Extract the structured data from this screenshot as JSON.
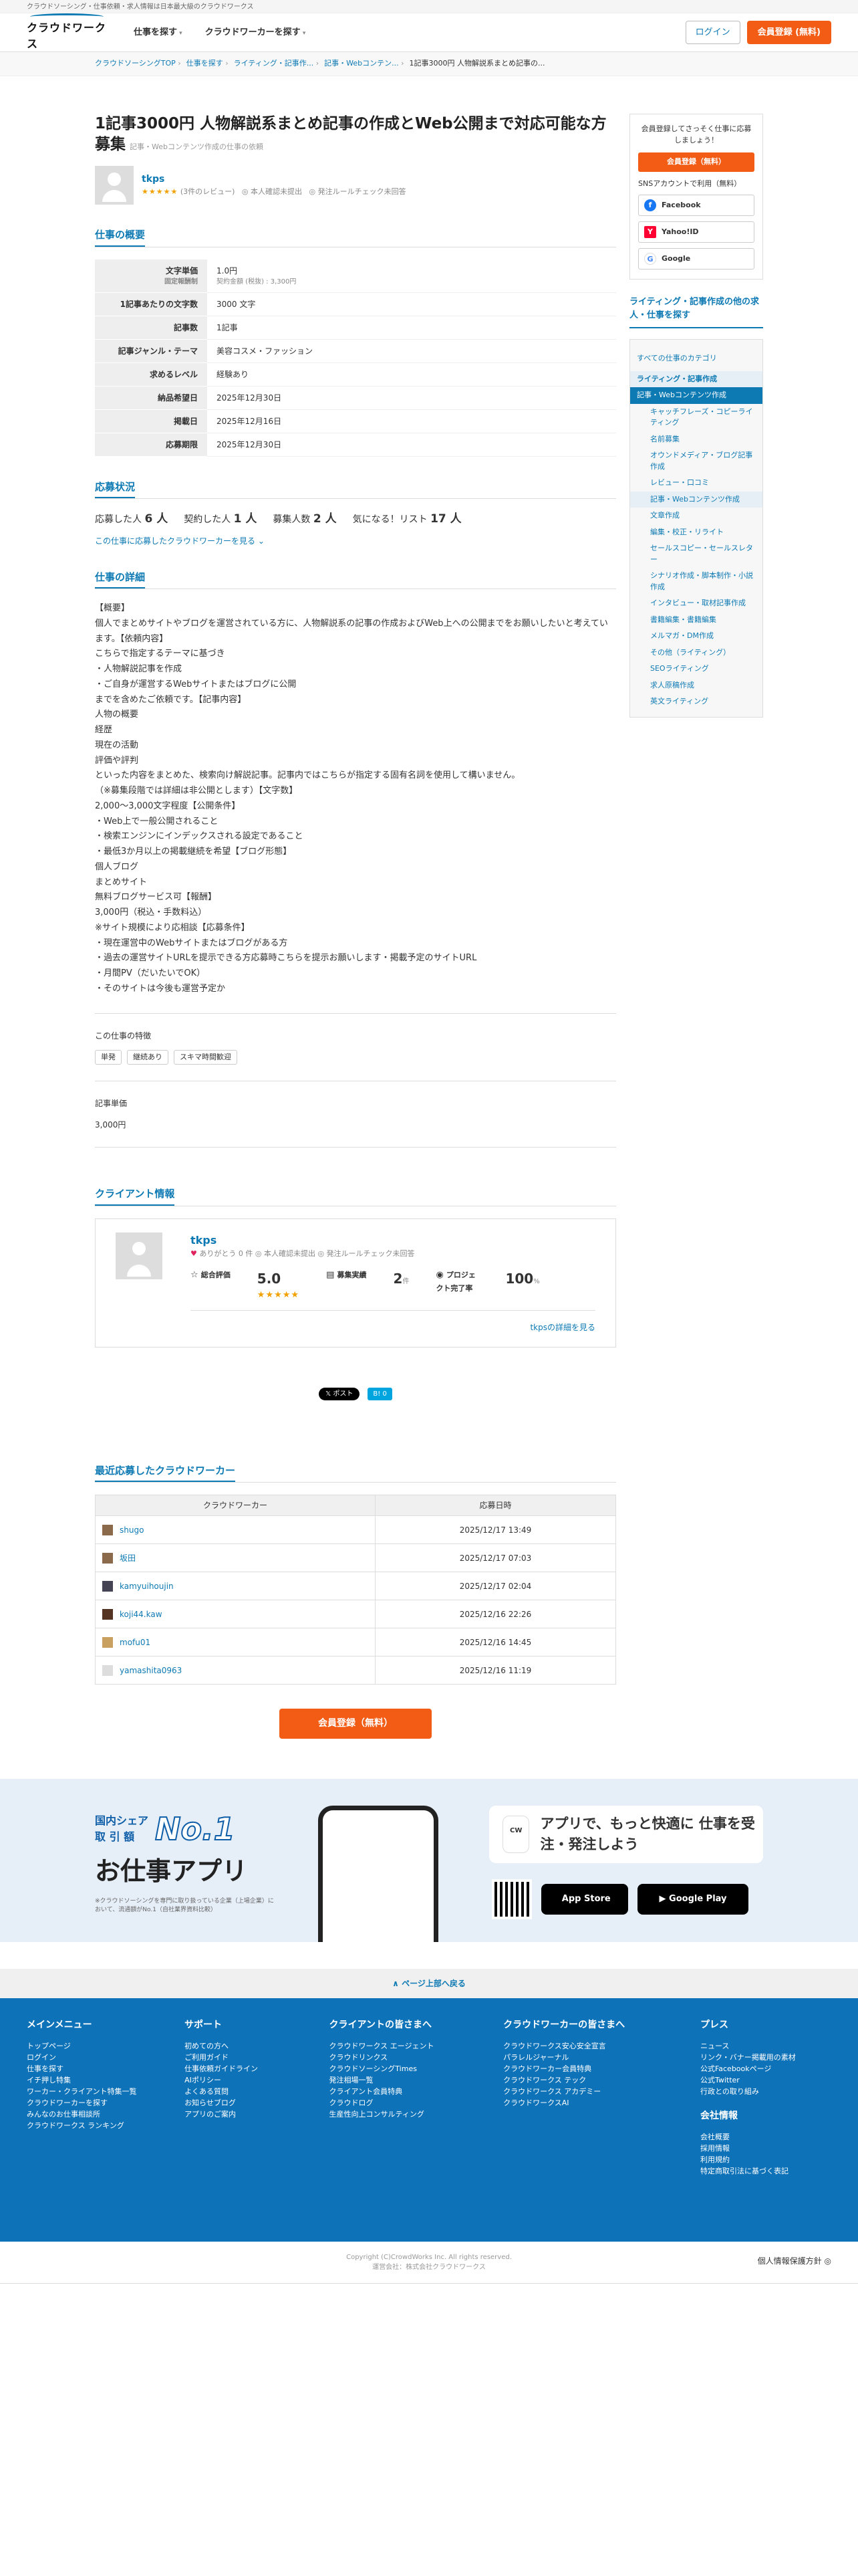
{
  "topbar": "クラウドソーシング・仕事依頼・求人情報は日本最大級のクラウドワークス",
  "header": {
    "logo": "クラウドワークス",
    "nav": [
      "仕事を探す",
      "クラウドワーカーを探す"
    ],
    "login": "ログイン",
    "register": "会員登録 (無料)"
  },
  "breadcrumb": [
    "クラウドソーシングTOP",
    "仕事を探す",
    "ライティング・記事作...",
    "記事・Webコンテン...",
    "1記事3000円 人物解説系まとめ記事の..."
  ],
  "job": {
    "title": "1記事3000円 人物解説系まとめ記事の作成とWeb公開まで対応可能な方募集",
    "category": "記事・Webコンテンツ作成の仕事の依頼"
  },
  "client": {
    "name": "tkps",
    "stars": "★★★★★",
    "reviews": "(3件のレビュー)",
    "identity": "本人確認未提出",
    "compliance": "発注ルールチェック未回答"
  },
  "overview": {
    "heading": "仕事の概要",
    "rows": [
      {
        "label": "文字単価",
        "sub": "固定報酬制",
        "value": "1.0円",
        "value_sub": "契約金額 (税抜) : 3,300円"
      },
      {
        "label": "1記事あたりの文字数",
        "value": "3000 文字"
      },
      {
        "label": "記事数",
        "value": "1記事"
      },
      {
        "label": "記事ジャンル・テーマ",
        "value": "美容コスメ・ファッション"
      },
      {
        "label": "求めるレベル",
        "value": "経験あり"
      },
      {
        "label": "納品希望日",
        "value": "2025年12月30日"
      },
      {
        "label": "掲載日",
        "value": "2025年12月16日"
      },
      {
        "label": "応募期限",
        "value": "2025年12月30日"
      }
    ]
  },
  "status": {
    "heading": "応募状況",
    "applicants_label": "応募した人",
    "applicants": "6 人",
    "contracted_label": "契約した人",
    "contracted": "1 人",
    "recruit_label": "募集人数",
    "recruit": "2 人",
    "watch_label": "気になる！リスト",
    "watch": "17 人",
    "more": "この仕事に応募したクラウドワーカーを見る"
  },
  "details": {
    "heading": "仕事の詳細",
    "text": "【概要】\n個人でまとめサイトやブログを運営されている方に、人物解説系の記事の作成およびWeb上への公開までをお願いしたいと考えています。【依頼内容】\nこちらで指定するテーマに基づき\n・人物解説記事を作成\n・ご自身が運営するWebサイトまたはブログに公開\nまでを含めたご依頼です。【記事内容】\n人物の概要\n経歴\n現在の活動\n評価や評判\nといった内容をまとめた、検索向け解説記事。記事内ではこちらが指定する固有名詞を使用して構いません。\n（※募集段階では詳細は非公開とします）【文字数】\n2,000〜3,000文字程度【公開条件】\n・Web上で一般公開されること\n・検索エンジンにインデックスされる設定であること\n・最低3か月以上の掲載継続を希望【ブログ形態】\n個人ブログ\nまとめサイト\n無料ブログサービス可【報酬】\n3,000円（税込・手数料込）\n※サイト規模により応相談【応募条件】\n・現在運営中のWebサイトまたはブログがある方\n・過去の運営サイトURLを提示できる方応募時こちらを提示お願いします・掲載予定のサイトURL\n・月間PV（だいたいでOK）\n・そのサイトは今後も運営予定か",
    "features_label": "この仕事の特徴",
    "features": [
      "単発",
      "継続あり",
      "スキマ時間歓迎"
    ],
    "price_label": "記事単価",
    "price": "3,000円"
  },
  "client_info": {
    "heading": "クライアント情報",
    "name": "tkps",
    "thanks": "ありがとう 0 件",
    "identity": "本人確認未提出",
    "compliance": "発注ルールチェック未回答",
    "rating_label": "総合評価",
    "rating": "5.0",
    "stars": "★★★★★",
    "jobs_label": "募集実績",
    "jobs": "2",
    "jobs_unit": "件",
    "completion_label": "プロジェクト完了率",
    "completion": "100",
    "completion_unit": "%",
    "detail_link": "tkpsの詳細を見る"
  },
  "share": {
    "x": "𝕏 ポスト",
    "hatena": "B! 0"
  },
  "recent": {
    "heading": "最近応募したクラウドワーカー",
    "col_worker": "クラウドワーカー",
    "col_date": "応募日時",
    "rows": [
      {
        "name": "shugo",
        "date": "2025/12/17 13:49"
      },
      {
        "name": "坂田",
        "date": "2025/12/17 07:03"
      },
      {
        "name": "kamyuihoujin",
        "date": "2025/12/17 02:04"
      },
      {
        "name": "koji44.kaw",
        "date": "2025/12/16 22:26"
      },
      {
        "name": "mofu01",
        "date": "2025/12/16 14:45"
      },
      {
        "name": "yamashita0963",
        "date": "2025/12/16 11:19"
      }
    ]
  },
  "cta": "会員登録（無料）",
  "sidebar": {
    "lead": "会員登録してさっそく仕事に応募しましょう！",
    "register": "会員登録（無料）",
    "sns_label": "SNSアカウントで利用（無料）",
    "facebook": "Facebook",
    "yahoo": "Yahoo!ID",
    "google": "Google",
    "cat_heading": "ライティング・記事作成の他の求人・仕事を探す",
    "cat_all": "すべての仕事のカテゴリ",
    "cat_top": "ライティング・記事作成",
    "cat_selected": "記事・Webコンテンツ作成",
    "cats": [
      "キャッチフレーズ・コピーライティング",
      "名前募集",
      "オウンドメディア・ブログ記事作成",
      "レビュー・口コミ",
      "記事・Webコンテンツ作成",
      "文章作成",
      "編集・校正・リライト",
      "セールスコピー・セールスレター",
      "シナリオ作成・脚本制作・小説作成",
      "インタビュー・取材記事作成",
      "書籍編集・書籍編集",
      "メルマガ・DM作成",
      "その他（ライティング）",
      "SEOライティング",
      "求人原稿作成",
      "英文ライティング"
    ]
  },
  "promo": {
    "share_label": "国内シェア",
    "amount_label": "取 引 額",
    "no1": "No.1",
    "app": "お仕事アプリ",
    "note": "※クラウドソーシングを専門に取り扱っている企業（上場企業）において、流通額がNo.1（自社業界資料比較）",
    "bubble": "アプリで、もっと快適に 仕事を受注・発注しよう",
    "appstore": "App Store",
    "googleplay": "Google Play"
  },
  "gotop": "∧ ページ上部へ戻る",
  "footer": {
    "cols": [
      {
        "title": "メインメニュー",
        "items": [
          "トップページ",
          "ログイン",
          "仕事を探す",
          "イチ押し特集",
          "ワーカー・クライアント特集一覧",
          "クラウドワーカーを探す",
          "みんなのお仕事相談所",
          "クラウドワークス ランキング"
        ]
      },
      {
        "title": "サポート",
        "items": [
          "初めての方へ",
          "ご利用ガイド",
          "仕事依頼ガイドライン",
          "AIポリシー",
          "よくある質問",
          "お知らせブログ",
          "アプリのご案内"
        ]
      },
      {
        "title": "クライアントの皆さまへ",
        "items": [
          "クラウドワークス エージェント",
          "クラウドリンクス",
          "クラウドソーシングTimes",
          "発注相場一覧",
          "クライアント会員特典",
          "クラウドログ",
          "生産性向上コンサルティング"
        ]
      },
      {
        "title": "クラウドワーカーの皆さまへ",
        "items": [
          "クラウドワークス安心安全宣言",
          "パラレルジャーナル",
          "クラウドワーカー会員特典",
          "クラウドワークス テック",
          "クラウドワークス アカデミー",
          "クラウドワークスAI"
        ]
      },
      {
        "title": "プレス",
        "items": [
          "ニュース",
          "リンク・バナー掲載用の素材",
          "公式Facebookページ",
          "公式Twitter",
          "行政との取り組み"
        ]
      }
    ],
    "company_title": "会社情報",
    "company": [
      "会社概要",
      "採用情報",
      "利用規約",
      "特定商取引法に基づく表記"
    ]
  },
  "copyright": "Copyright (C)CrowdWorks Inc. All rights reserved.",
  "operator": "運営会社：株式会社クラウドワークス",
  "privacy": "個人情報保護方針"
}
